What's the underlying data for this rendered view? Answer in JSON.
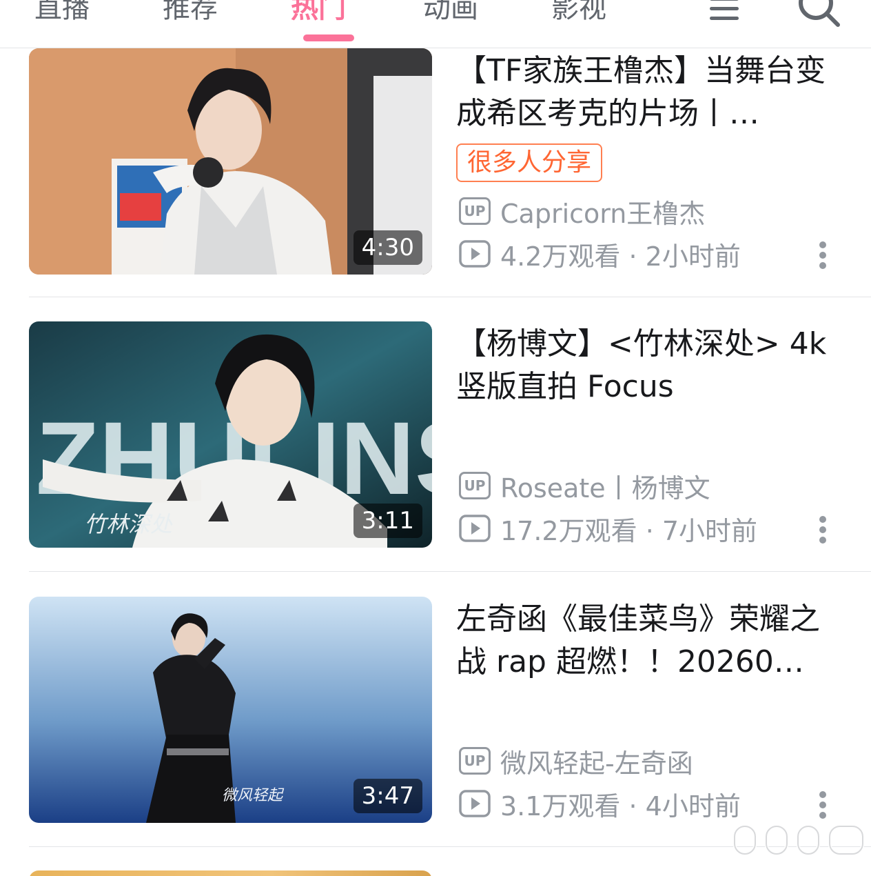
{
  "tabs": [
    {
      "label": "直播",
      "active": false
    },
    {
      "label": "推荐",
      "active": false
    },
    {
      "label": "热门",
      "active": true
    },
    {
      "label": "动画",
      "active": false
    },
    {
      "label": "影视",
      "active": false
    }
  ],
  "icons": {
    "menu": "menu-icon",
    "search": "search-icon",
    "up": "up-icon",
    "views": "play-count-icon",
    "more": "more-vertical-icon"
  },
  "colors": {
    "accent": "#fb7299",
    "badge": "#ff6633",
    "meta": "#9499a0"
  },
  "videos": [
    {
      "title": "【TF家族王橹杰】当舞台变成希区考克的片场丨…",
      "badge": "很多人分享",
      "up_label": "UP",
      "uploader": "Capricorn王橹杰",
      "stats": "4.2万观看 · 2小时前",
      "duration": "4:30"
    },
    {
      "title": "【杨博文】<竹林深处> 4k竖版直拍 Focus",
      "badge": "",
      "up_label": "UP",
      "uploader": "Roseate丨杨博文",
      "stats": "17.2万观看 · 7小时前",
      "duration": "3:11",
      "thumb_text_big": "ZHULINSHENCHU",
      "thumb_text_small": "竹林深处"
    },
    {
      "title": "左奇函《最佳菜鸟》荣耀之战 rap 超燃！！20260…",
      "badge": "",
      "up_label": "UP",
      "uploader": "微风轻起-左奇函",
      "stats": "3.1万观看 · 4小时前",
      "duration": "3:47",
      "thumb_text_small": "微风轻起"
    }
  ]
}
